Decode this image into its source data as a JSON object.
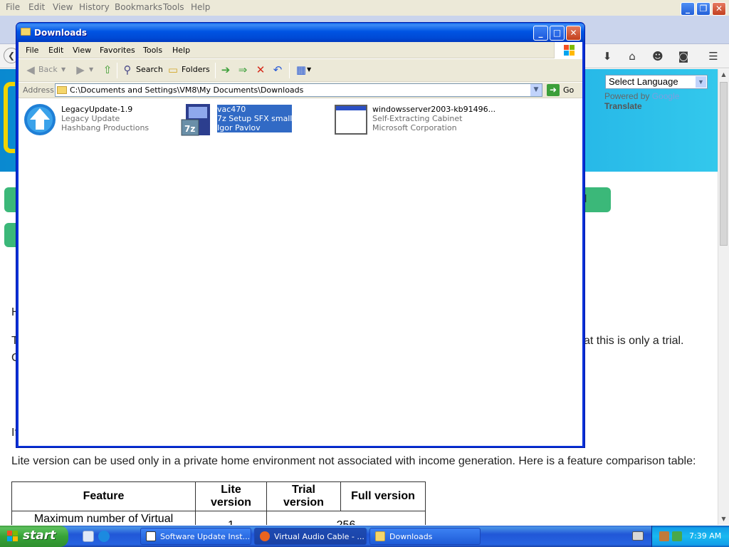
{
  "firefox": {
    "menu": [
      "File",
      "Edit",
      "View",
      "History",
      "Bookmarks",
      "Tools",
      "Help"
    ],
    "window_controls": {
      "minimize": "_",
      "restore": "❐",
      "close": "✕"
    }
  },
  "site": {
    "translate": {
      "select_label": "Select Language",
      "powered_by": "Powered by",
      "google": "Google",
      "translate": "Translate"
    },
    "button_fragment": "d",
    "text_h": "H",
    "text_t": "T",
    "text_c": "C",
    "text_if": "If",
    "trial_line_fragment": "at this is only a trial.",
    "lite_text": "Lite version can be used only in a private home environment not associated with income generation. Here is a feature comparison table:",
    "table": {
      "headers": [
        "Feature",
        "Lite version",
        "Trial version",
        "Full version"
      ],
      "row1": {
        "feature": "Maximum number of Virtual Cables",
        "lite": "1",
        "trial_full": "256"
      }
    }
  },
  "explorer": {
    "title": "Downloads",
    "menu": [
      "File",
      "Edit",
      "View",
      "Favorites",
      "Tools",
      "Help"
    ],
    "toolbar": {
      "back": "Back",
      "search": "Search",
      "folders": "Folders"
    },
    "address_label": "Address",
    "address": "C:\\Documents and Settings\\VM8\\My Documents\\Downloads",
    "go": "Go",
    "files": [
      {
        "name": "LegacyUpdate-1.9",
        "desc": "Legacy Update",
        "company": "Hashbang Productions"
      },
      {
        "name": "vac470",
        "desc": "7z Setup SFX small",
        "company": "Igor Pavlov"
      },
      {
        "name": "windowsserver2003-kb91496...",
        "desc": "Self-Extracting Cabinet",
        "company": "Microsoft Corporation"
      }
    ]
  },
  "taskbar": {
    "start": "start",
    "tasks": [
      "Software Update Inst...",
      "Virtual Audio Cable - ...",
      "Downloads"
    ],
    "clock": "7:39 AM"
  },
  "colors": {
    "xp_blue": "#0054e3",
    "selection": "#316ac5",
    "site_green": "#3bb879",
    "banner": "#1aa7e3"
  }
}
